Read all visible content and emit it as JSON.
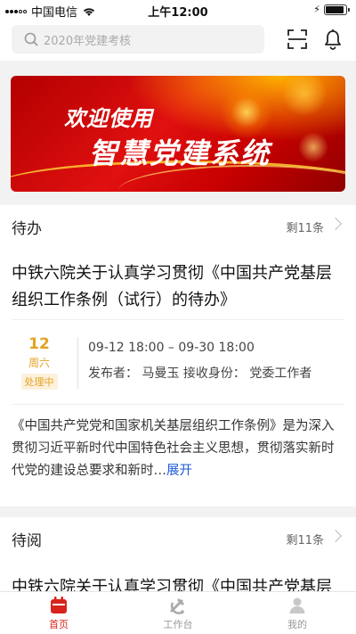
{
  "status_bar": {
    "carrier": "中国电信",
    "time": "上午12:00"
  },
  "header": {
    "search_placeholder": "2020年党建考核",
    "icons": [
      "search-icon",
      "scan-icon",
      "bell-icon"
    ]
  },
  "banner": {
    "line1": "欢迎使用",
    "line2": "智慧党建系统"
  },
  "todo_section": {
    "title": "待办",
    "count": "剩11条",
    "item": {
      "title": "中铁六院关于认真学习贯彻《中国共产党基层组织工作条例（试行）的待办》",
      "day": "12",
      "weekday": "周六",
      "status": "处理中",
      "time_range": "09-12 18:00 – 09-30 18:00",
      "meta": "发布者：  马曼玉   接收身份：  党委工作者",
      "description": "《中国共产党党和国家机关基层组织工作条例》是为深入贯彻习近平新时代中国特色社会主义思想，贯彻落实新时代党的建设总要求和新时…",
      "more": "展开"
    }
  },
  "toread_section": {
    "title": "待阅",
    "count": "剩11条",
    "item_title": "中铁六院关于认真学习贯彻《中国共产党基层"
  },
  "tabbar": {
    "tabs": [
      {
        "label": "首页",
        "icon": "calendar-icon",
        "active": true
      },
      {
        "label": "工作台",
        "icon": "party-emblem-icon",
        "active": false
      },
      {
        "label": "我的",
        "icon": "person-icon",
        "active": false
      }
    ]
  },
  "colors": {
    "brand_red": "#d7231b",
    "status_orange": "#e3a321",
    "link_blue": "#1e5bd6"
  }
}
